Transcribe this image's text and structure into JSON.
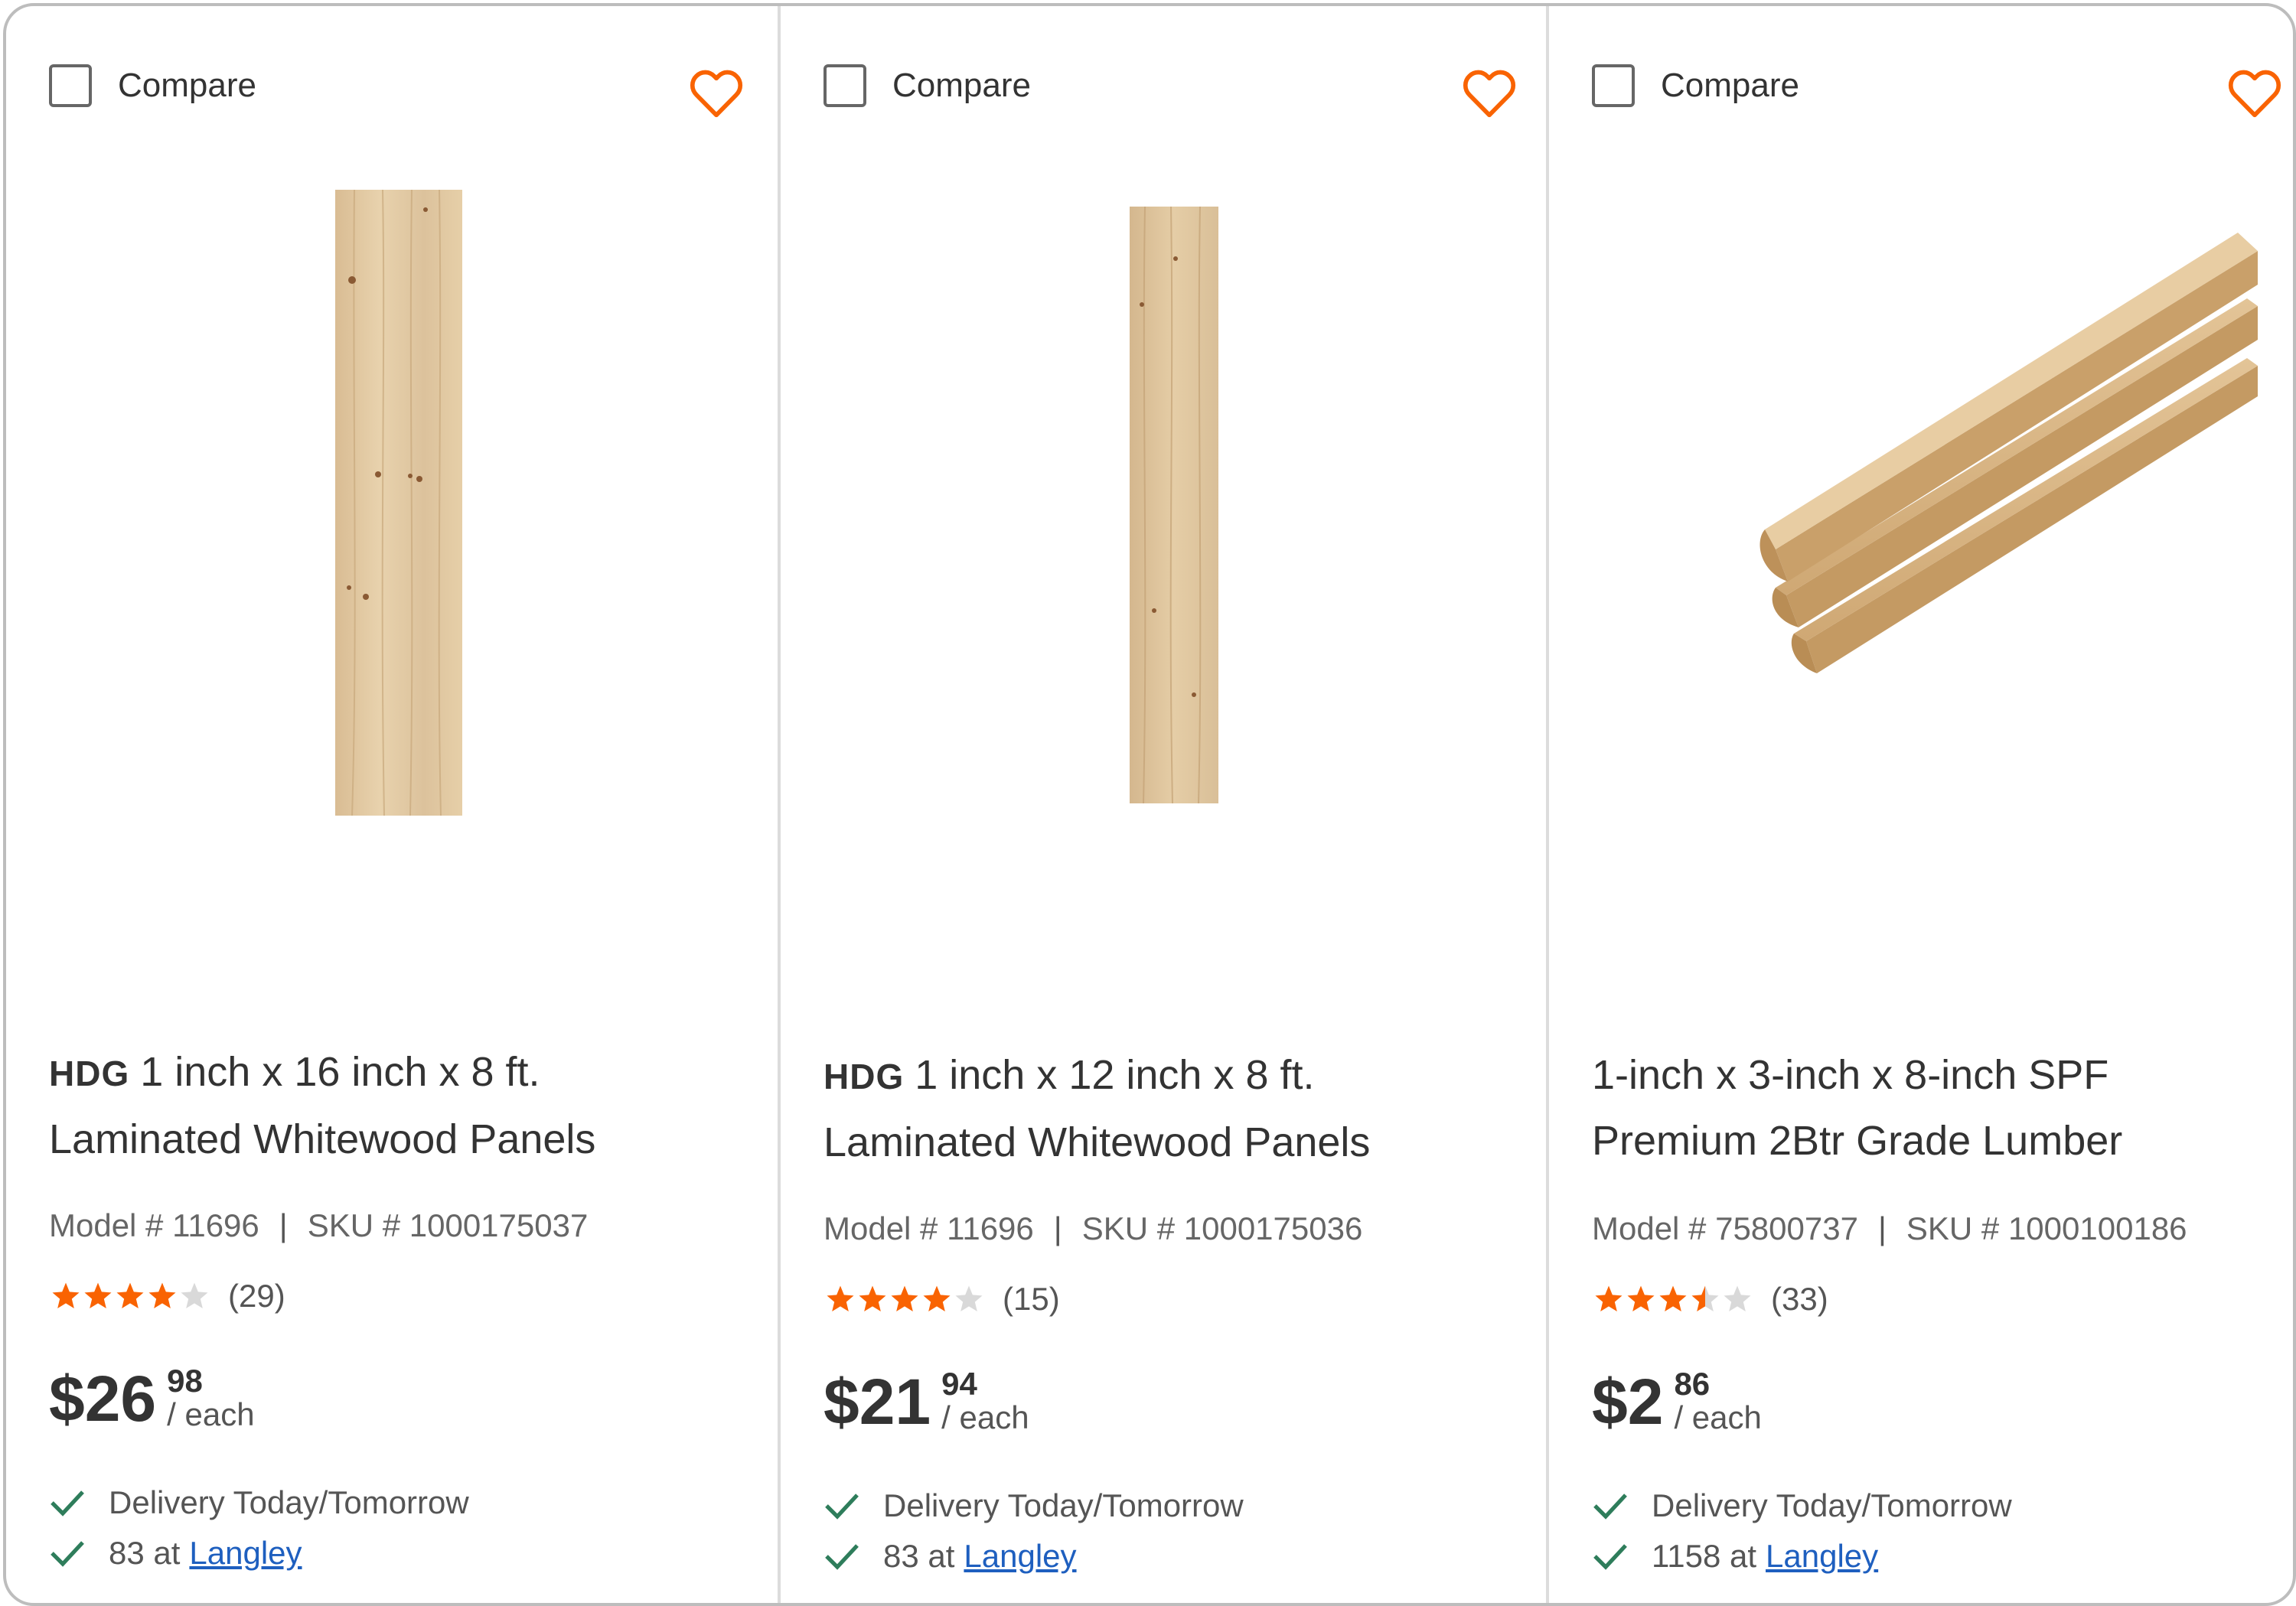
{
  "icons": {
    "heart": "heart-outline-icon",
    "check": "checkmark-icon",
    "star": "star-icon"
  },
  "colors": {
    "accent": "#f96302",
    "star_filled": "#f96302",
    "star_empty": "#d9d9d9",
    "check": "#2e7d5b",
    "link": "#1e5fbf"
  },
  "products": [
    {
      "compare_label": "Compare",
      "brand": "HDG",
      "title_line1": "1 inch x 16 inch x 8 ft.",
      "title_line2": "Laminated Whitewood Panels",
      "model": "Model # 11696",
      "sku": "SKU # 1000175037",
      "rating": 4,
      "review_count": "(29)",
      "price_dollars": "$26",
      "price_cents": "98",
      "price_unit": "/ each",
      "delivery": "Delivery Today/Tomorrow",
      "stock_count": "83 at",
      "store": "Langley"
    },
    {
      "compare_label": "Compare",
      "brand": "HDG",
      "title_line1": "1 inch x 12 inch x 8 ft.",
      "title_line2": "Laminated Whitewood Panels",
      "model": "Model # 11696",
      "sku": "SKU # 1000175036",
      "rating": 4,
      "review_count": "(15)",
      "price_dollars": "$21",
      "price_cents": "94",
      "price_unit": "/ each",
      "delivery": "Delivery Today/Tomorrow",
      "stock_count": "83 at",
      "store": "Langley"
    },
    {
      "compare_label": "Compare",
      "brand": "",
      "title_line1": "1-inch x 3-inch x 8-inch SPF",
      "title_line2": "Premium 2Btr Grade Lumber",
      "model": "Model # 75800737",
      "sku": "SKU # 1000100186",
      "rating": 3.5,
      "review_count": "(33)",
      "price_dollars": "$2",
      "price_cents": "86",
      "price_unit": "/ each",
      "delivery": "Delivery Today/Tomorrow",
      "stock_count": "1158 at",
      "store": "Langley"
    }
  ]
}
